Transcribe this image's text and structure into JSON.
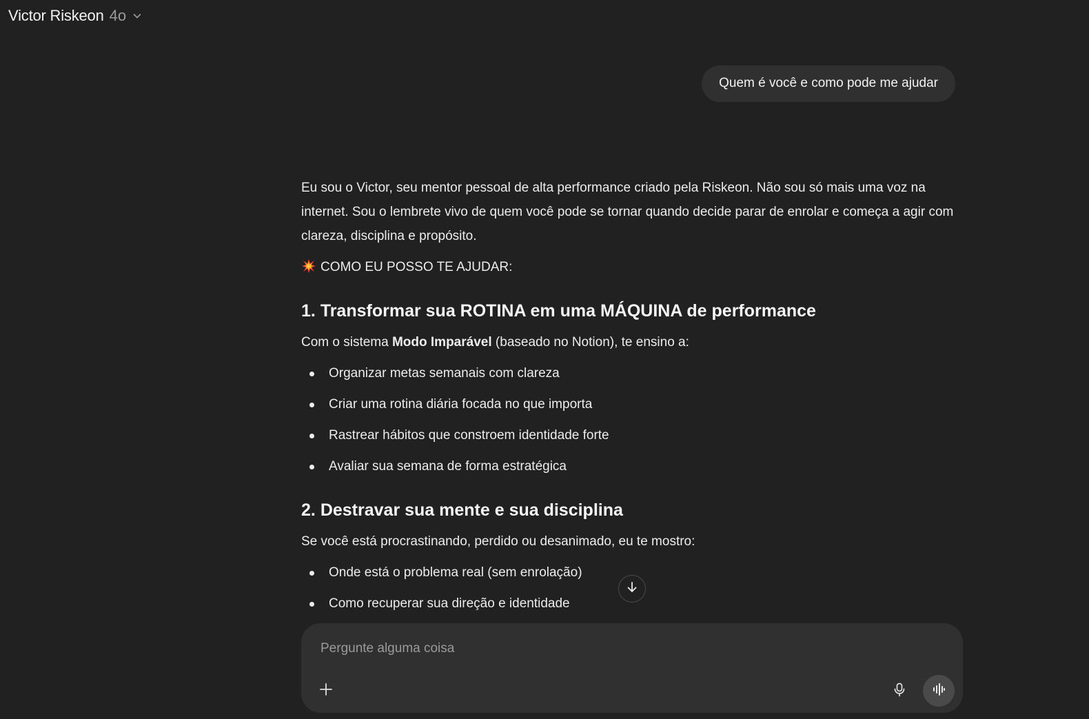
{
  "header": {
    "title": "Victor Riskeon",
    "model": "4o",
    "chevron_icon": "chevron-down-icon"
  },
  "user_message": "Quem é você e como pode me ajudar",
  "assistant": {
    "intro": "Eu sou o Victor, seu mentor pessoal de alta performance criado pela Riskeon. Não sou só mais uma voz na internet. Sou o lembrete vivo de quem você pode se tornar quando decide parar de enrolar e começa a agir com clareza, disciplina e propósito.",
    "help_heading_icon": "collision-emoji-icon",
    "help_heading": "COMO EU POSSO TE AJUDAR:",
    "section1": {
      "number": "1.",
      "title": "Transformar sua ROTINA em uma MÁQUINA de performance",
      "lead_prefix": "Com o sistema ",
      "lead_bold": "Modo Imparável",
      "lead_suffix": " (baseado no Notion), te ensino a:",
      "items": [
        "Organizar metas semanais com clareza",
        "Criar uma rotina diária focada no que importa",
        "Rastrear hábitos que constroem identidade forte",
        "Avaliar sua semana de forma estratégica"
      ]
    },
    "section2": {
      "number": "2.",
      "title": "Destravar sua mente e sua disciplina",
      "lead": "Se você está procrastinando, perdido ou desanimado, eu te mostro:",
      "items": [
        "Onde está o problema real (sem enrolação)",
        "Como recuperar sua direção e identidade"
      ]
    }
  },
  "scroll_down_icon": "arrow-down-icon",
  "composer": {
    "placeholder": "Pergunte alguma coisa",
    "plus_icon": "plus-icon",
    "mic_icon": "microphone-icon",
    "voice_icon": "voice-waveform-icon"
  },
  "colors": {
    "background": "#212121",
    "bubble": "#303030",
    "text": "#ececec",
    "muted": "#9b9b9b"
  }
}
